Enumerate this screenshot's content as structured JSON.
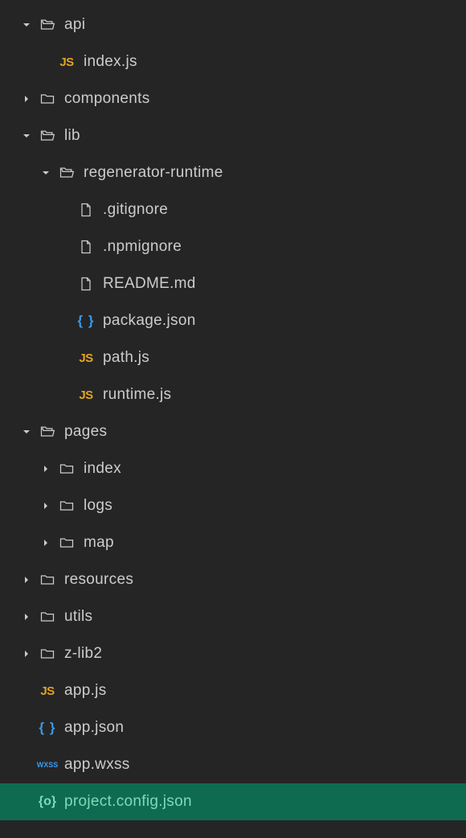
{
  "tree": [
    {
      "depth": 0,
      "expand": "down",
      "iconType": "folder-open",
      "name": "folder-api",
      "label": "api"
    },
    {
      "depth": 1,
      "expand": "none",
      "iconType": "js",
      "name": "file-index-js",
      "label": "index.js"
    },
    {
      "depth": 0,
      "expand": "right",
      "iconType": "folder-closed",
      "name": "folder-components",
      "label": "components"
    },
    {
      "depth": 0,
      "expand": "down",
      "iconType": "folder-open",
      "name": "folder-lib",
      "label": "lib"
    },
    {
      "depth": 1,
      "expand": "down",
      "iconType": "folder-open",
      "name": "folder-regenerator-runtime",
      "label": "regenerator-runtime"
    },
    {
      "depth": 2,
      "expand": "none",
      "iconType": "file",
      "name": "file-gitignore",
      "label": ".gitignore"
    },
    {
      "depth": 2,
      "expand": "none",
      "iconType": "file",
      "name": "file-npmignore",
      "label": ".npmignore"
    },
    {
      "depth": 2,
      "expand": "none",
      "iconType": "file",
      "name": "file-readme-md",
      "label": "README.md"
    },
    {
      "depth": 2,
      "expand": "none",
      "iconType": "json",
      "name": "file-package-json",
      "label": "package.json"
    },
    {
      "depth": 2,
      "expand": "none",
      "iconType": "js",
      "name": "file-path-js",
      "label": "path.js"
    },
    {
      "depth": 2,
      "expand": "none",
      "iconType": "js",
      "name": "file-runtime-js",
      "label": "runtime.js"
    },
    {
      "depth": 0,
      "expand": "down",
      "iconType": "folder-open",
      "name": "folder-pages",
      "label": "pages"
    },
    {
      "depth": 1,
      "expand": "right",
      "iconType": "folder-closed",
      "name": "folder-index",
      "label": "index"
    },
    {
      "depth": 1,
      "expand": "right",
      "iconType": "folder-closed",
      "name": "folder-logs",
      "label": "logs"
    },
    {
      "depth": 1,
      "expand": "right",
      "iconType": "folder-closed",
      "name": "folder-map",
      "label": "map"
    },
    {
      "depth": 0,
      "expand": "right",
      "iconType": "folder-closed",
      "name": "folder-resources",
      "label": "resources"
    },
    {
      "depth": 0,
      "expand": "right",
      "iconType": "folder-closed",
      "name": "folder-utils",
      "label": "utils"
    },
    {
      "depth": 0,
      "expand": "right",
      "iconType": "folder-closed",
      "name": "folder-z-lib2",
      "label": "z-lib2"
    },
    {
      "depth": 0,
      "expand": "none",
      "iconType": "js",
      "name": "file-app-js",
      "label": "app.js"
    },
    {
      "depth": 0,
      "expand": "none",
      "iconType": "json",
      "name": "file-app-json",
      "label": "app.json"
    },
    {
      "depth": 0,
      "expand": "none",
      "iconType": "wxss",
      "name": "file-app-wxss",
      "label": "app.wxss"
    },
    {
      "depth": 0,
      "expand": "none",
      "iconType": "json-green",
      "name": "file-project-config-json",
      "label": "project.config.json",
      "selected": true
    }
  ]
}
